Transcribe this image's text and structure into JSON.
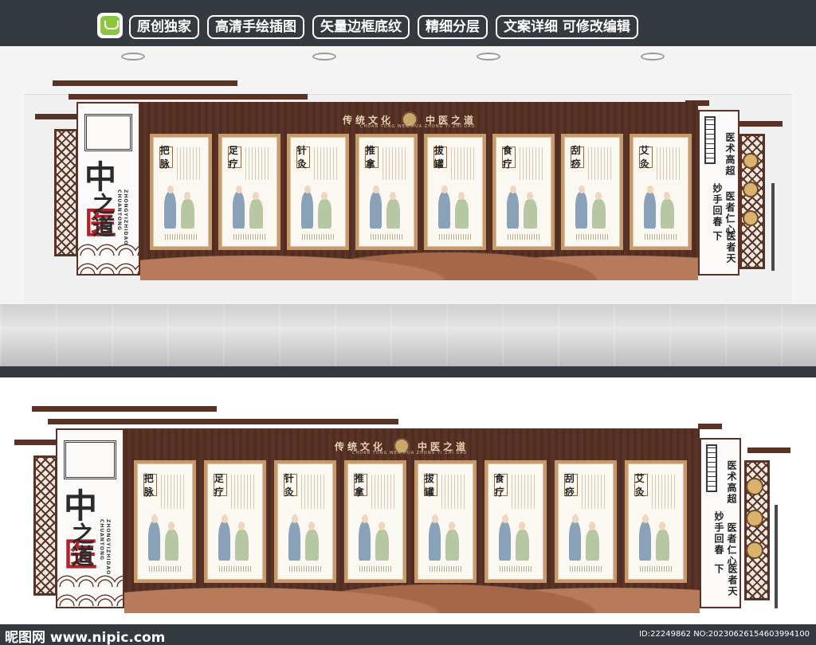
{
  "banner": {
    "tags": [
      "原创独家",
      "高清手绘插图",
      "矢量边框底纹",
      "精细分层",
      "文案详细 可修改编辑"
    ]
  },
  "display": {
    "main_title_1": "中",
    "main_title_2": "医",
    "main_title_3": "之道",
    "pinyin": "ZHONGYIZHIDAO",
    "pinyin_top": "CHUANTONG",
    "header": {
      "left": "传统文化",
      "right": "中医之道",
      "sub": "CHUAN TONG WEN HUA ZHONG YI ZHI DAO"
    },
    "panels": [
      "把脉",
      "足疗",
      "针灸",
      "推拿",
      "拔罐",
      "食疗",
      "刮痧",
      "艾灸"
    ],
    "right_col_1": "医术高超",
    "right_col_2": "妙手回春",
    "right_col_3": "医者仁心",
    "right_col_4": "医者天下"
  },
  "watermark": {
    "site": "昵图网 www.nipic.com",
    "id": "ID:22249862 NO:20230626154603994100"
  }
}
